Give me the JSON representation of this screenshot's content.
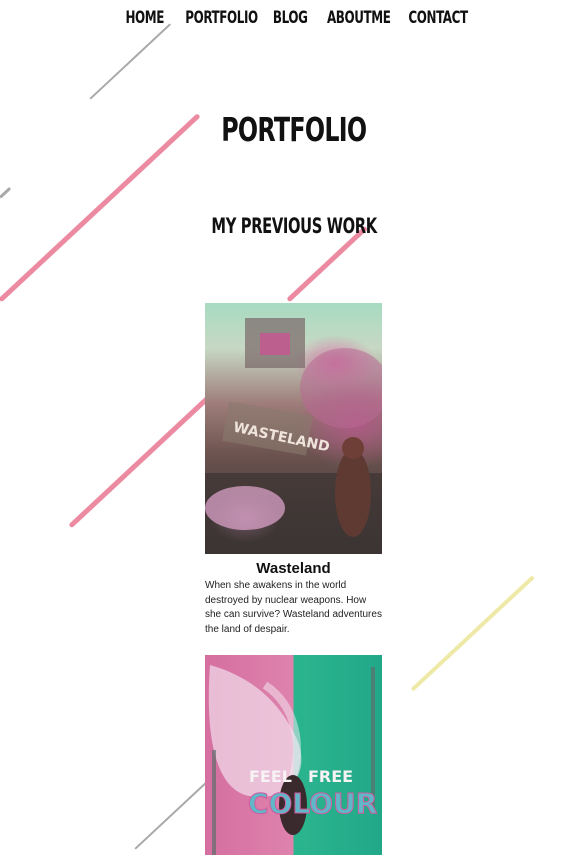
{
  "nav": {
    "items": [
      "HOME",
      "PORTFOLIO",
      "BLOG",
      "ABOUTME",
      "CONTACT"
    ]
  },
  "page": {
    "title": "PORTFOLIO",
    "section_title": "MY PREVIOUS WORK"
  },
  "works": [
    {
      "title": "Wasteland",
      "description": "When she awakens in the world destroyed by nuclear weapons. How she can survive? Wasteland adventures the land of despair.",
      "image_text": "WASTELAND"
    },
    {
      "image_text_top_left": "FEEL",
      "image_text_top_right": "FREE",
      "image_text_main": "COLOUR"
    }
  ],
  "colors": {
    "pink_streak": "#e8768f",
    "gray_streak": "#a9a9a9",
    "yellow_streak": "#efe9a8",
    "text": "#111111"
  }
}
